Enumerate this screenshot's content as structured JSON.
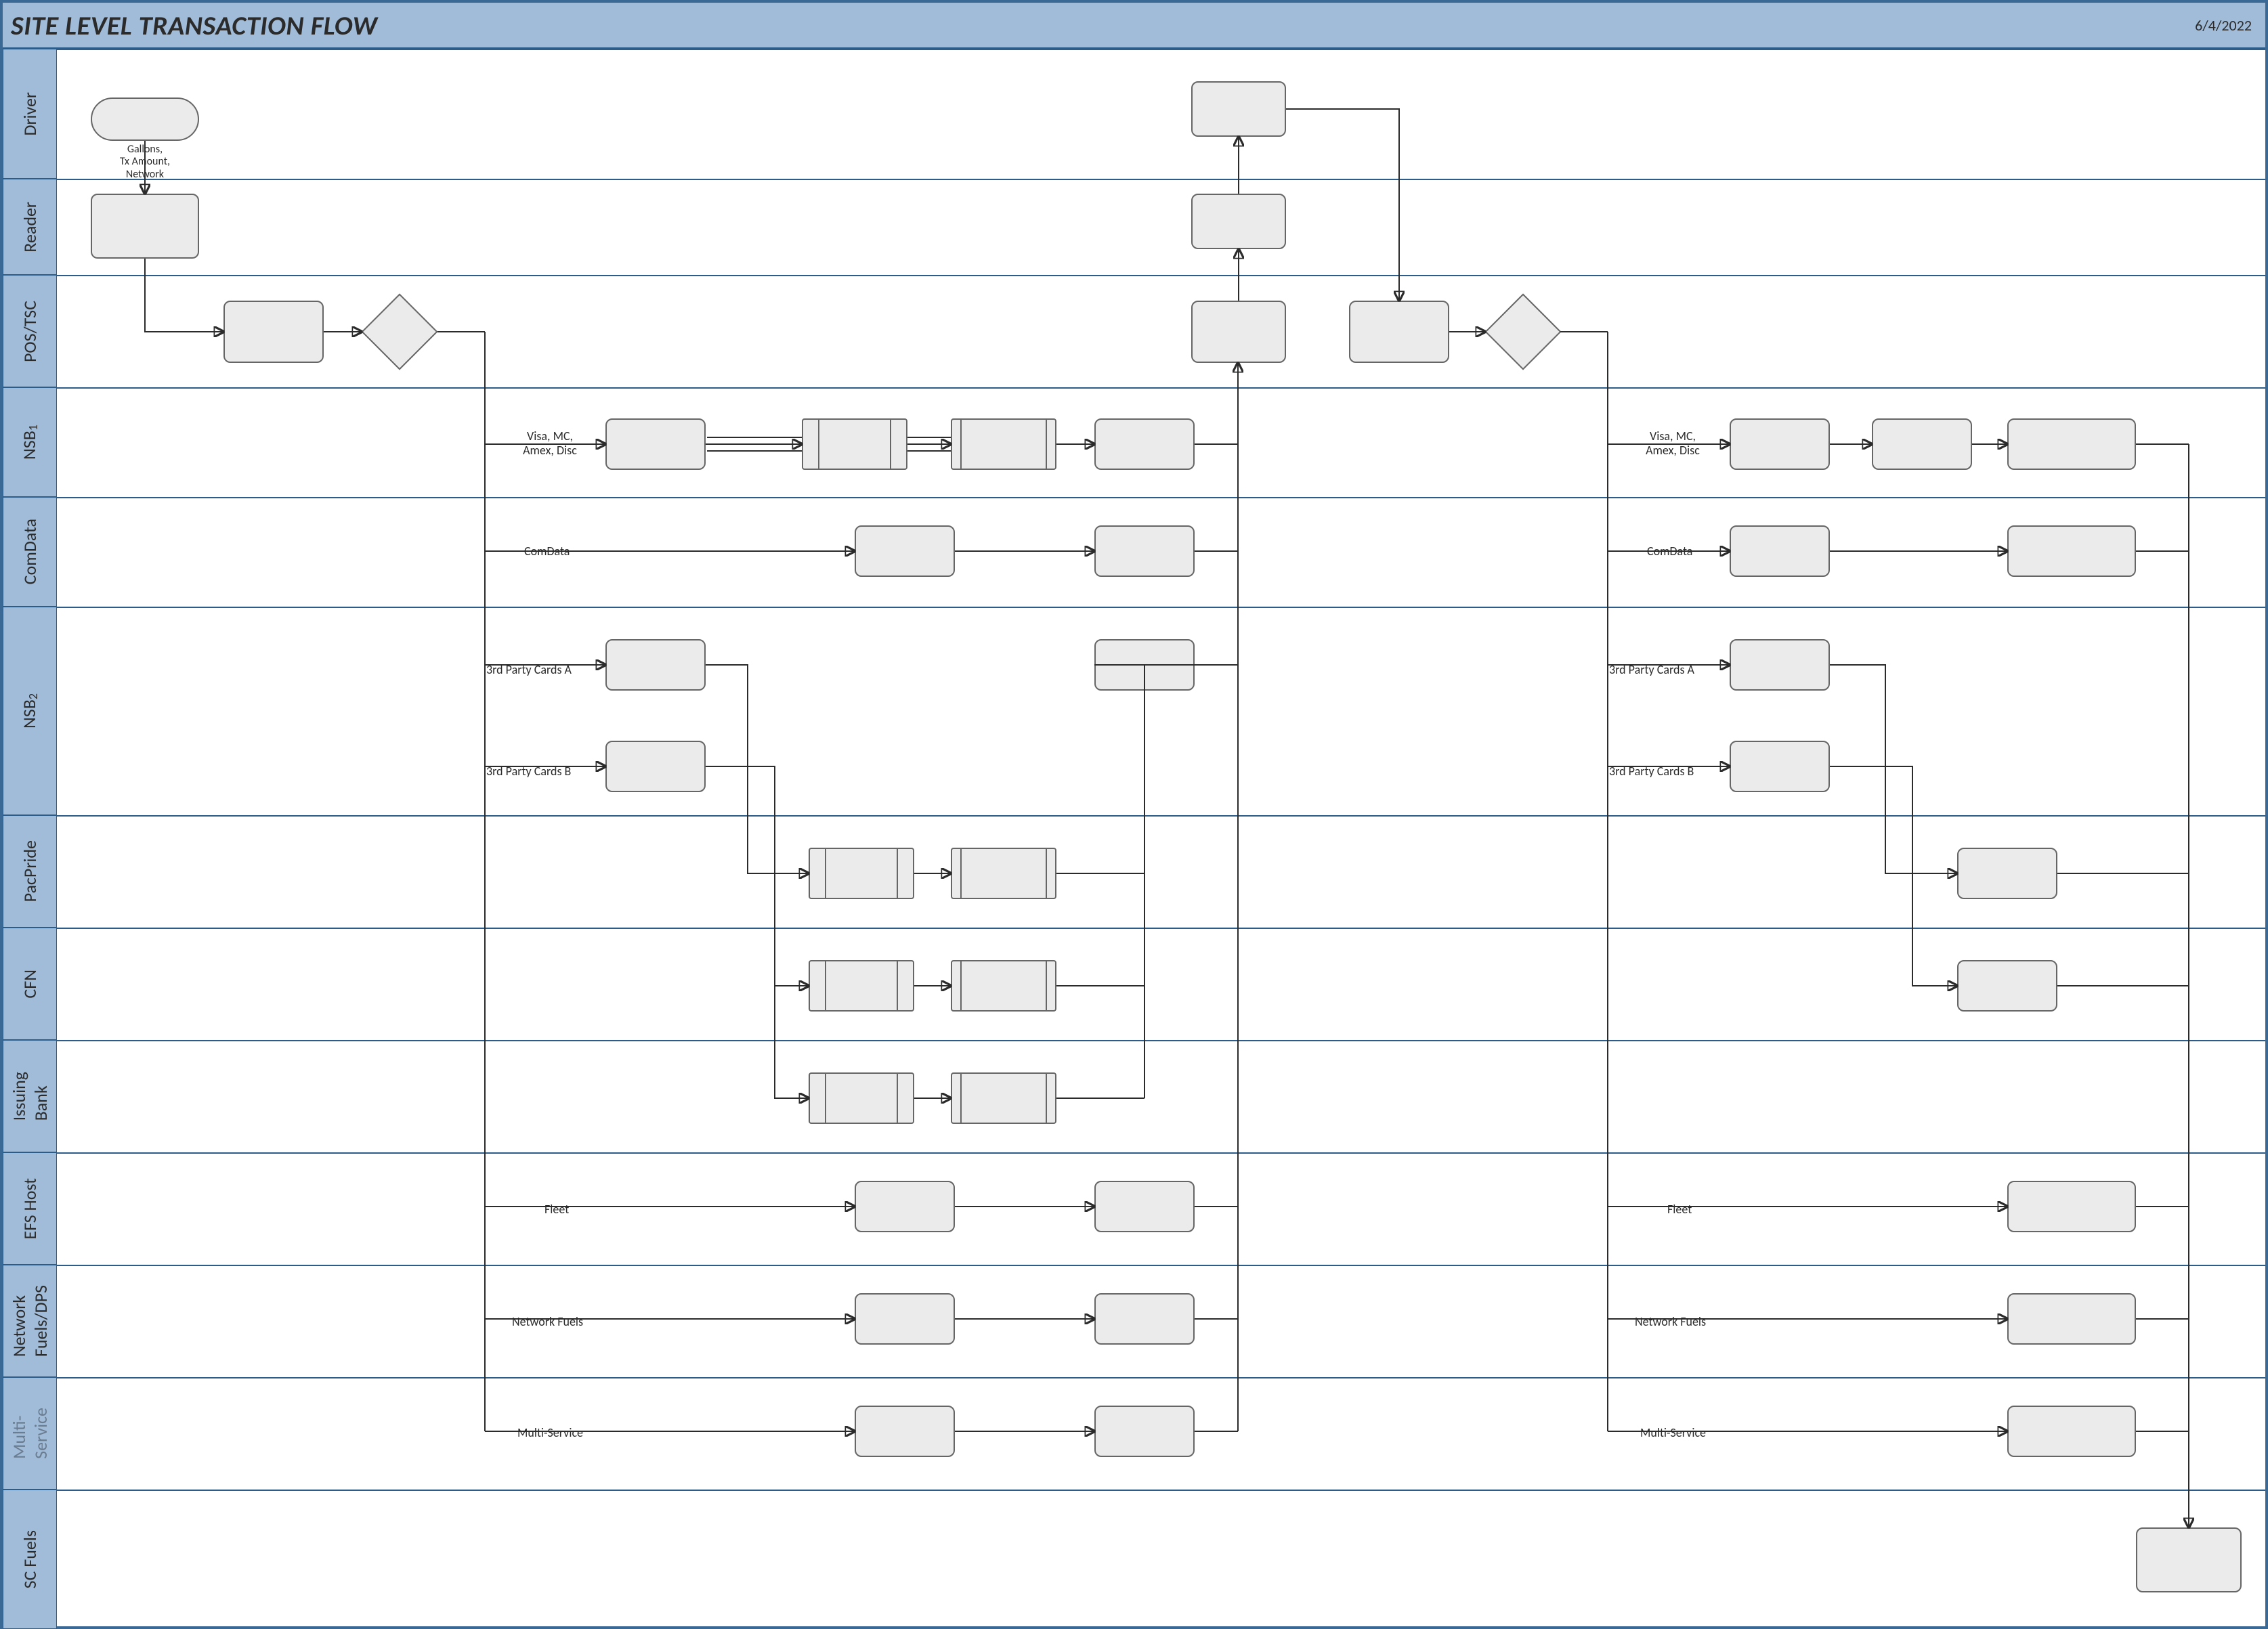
{
  "header": {
    "title": "SITE LEVEL TRANSACTION FLOW",
    "date": "6/4/2022"
  },
  "lanes": [
    {
      "id": "driver",
      "label": "Driver"
    },
    {
      "id": "reader",
      "label": "Reader"
    },
    {
      "id": "pos",
      "label": "POS/TSC"
    },
    {
      "id": "nsb1",
      "label": "NSB",
      "sub": "1"
    },
    {
      "id": "comdata",
      "label": "ComData"
    },
    {
      "id": "nsb2",
      "label": "NSB",
      "sub": "2"
    },
    {
      "id": "pacpride",
      "label": "PacPride"
    },
    {
      "id": "cfn",
      "label": "CFN"
    },
    {
      "id": "issuing",
      "label": "Issuing\nBank"
    },
    {
      "id": "efs",
      "label": "EFS Host"
    },
    {
      "id": "network",
      "label": "Network\nFuels/DPS"
    },
    {
      "id": "multi",
      "label": "Multi-\nService",
      "faded": true
    },
    {
      "id": "scfuels",
      "label": "SC Fuels"
    }
  ],
  "text": {
    "driverOut": "Gallons,\nTx Amount,\nNetwork",
    "left": {
      "visaMc": "Visa, MC,\nAmex, Disc",
      "comdata": "ComData",
      "thirdA": "3rd Party Cards A",
      "thirdB": "3rd Party Cards B",
      "fleet": "Fleet",
      "netfuels": "Network Fuels",
      "multisvc": "Multi-Service"
    },
    "right": {
      "visaMc": "Visa, MC,\nAmex, Disc",
      "comdata": "ComData",
      "thirdA": "3rd Party Cards A",
      "thirdB": "3rd Party Cards B",
      "fleet": "Fleet",
      "netfuels": "Network Fuels",
      "multisvc": "Multi-Service"
    }
  }
}
